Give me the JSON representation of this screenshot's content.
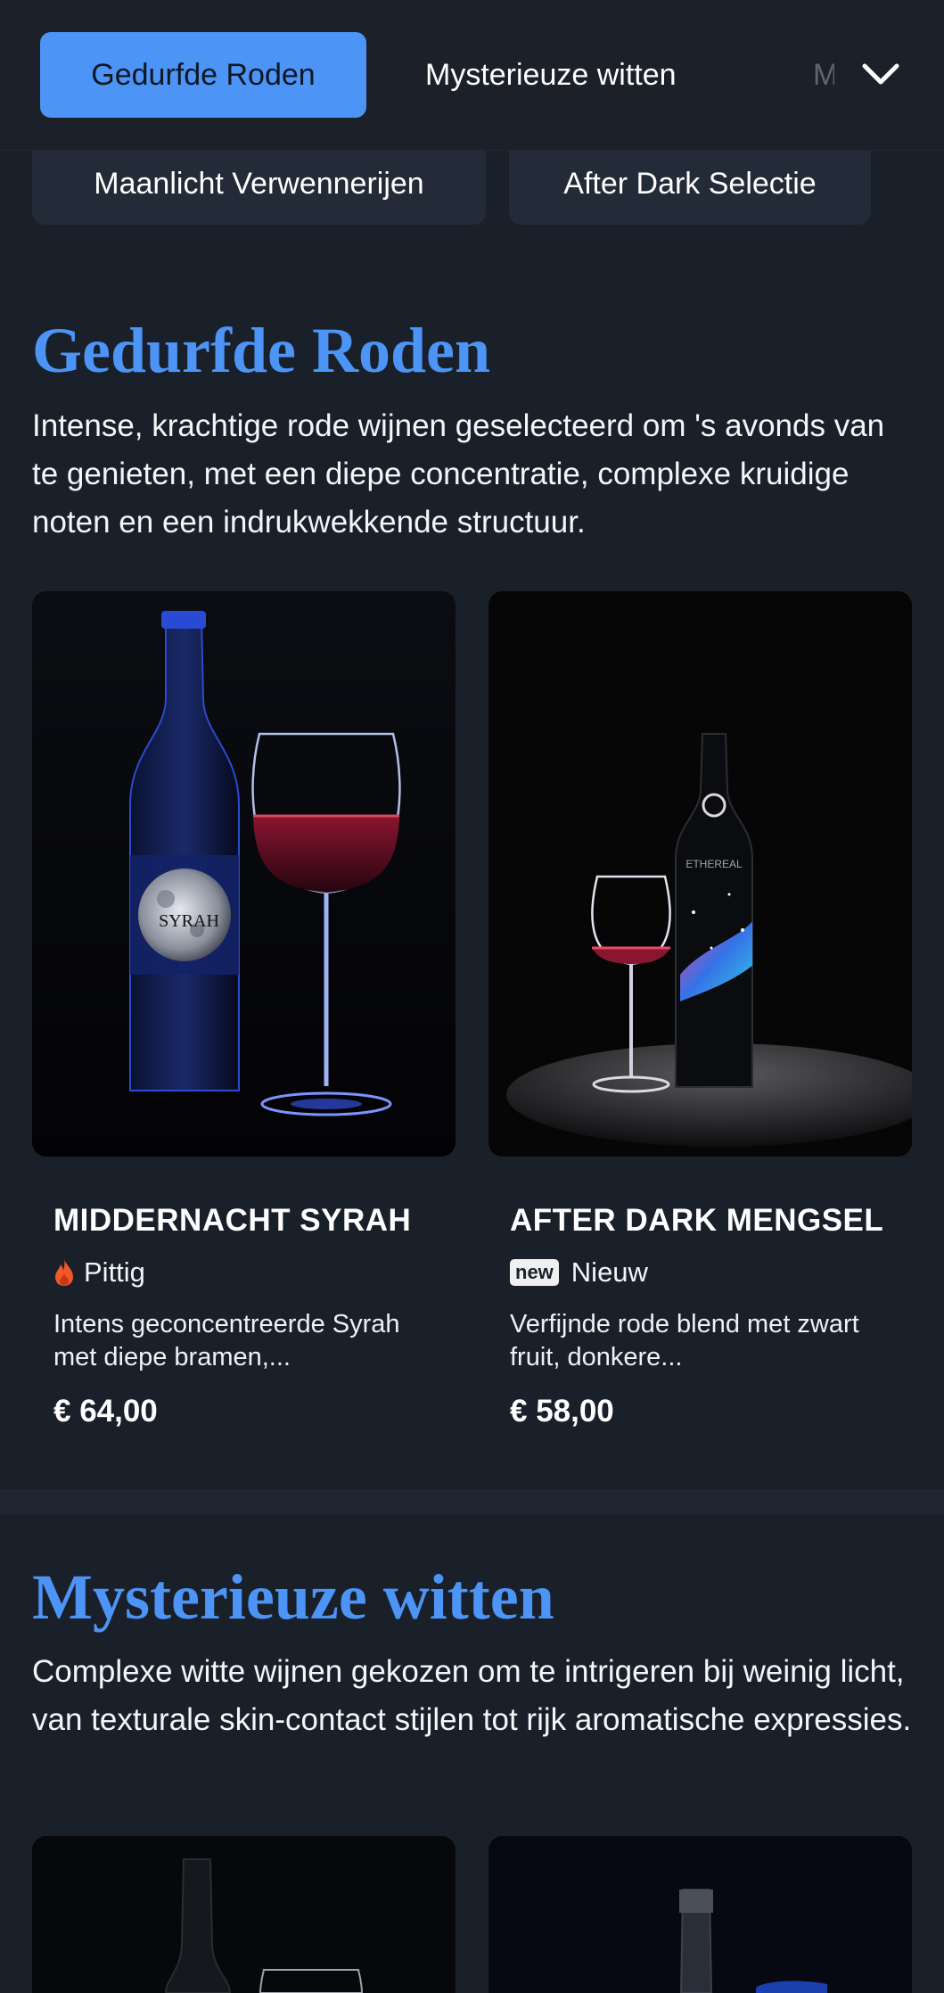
{
  "nav": {
    "tabs": [
      {
        "label": "Gedurfde Roden",
        "active": true
      },
      {
        "label": "Mysterieuze witten",
        "active": false
      },
      {
        "label": "M",
        "active": false
      }
    ],
    "more_icon": "chevron-down-icon"
  },
  "category_pills": [
    {
      "label": "Maanlicht Verwennerijen"
    },
    {
      "label": "After Dark Selectie"
    }
  ],
  "sections": [
    {
      "title": "Gedurfde Roden",
      "description": "Intense, krachtige rode wijnen geselecteerd om 's avonds van te genieten, met een diepe concentratie, complexe kruidige noten en een indrukwekkende structuur.",
      "products": [
        {
          "name": "MIDDERNACHT SYRAH",
          "badge_label": "Pittig",
          "badge_icon": "flame-icon",
          "description": "Intens geconcentreerde Syrah met diepe bramen,...",
          "price": "€ 64,00",
          "bottle_label": "SYRAH"
        },
        {
          "name": "AFTER DARK MENGSEL",
          "badge_pill": "new",
          "badge_label": "Nieuw",
          "description": "Verfijnde rode blend met zwart fruit, donkere...",
          "price": "€ 58,00",
          "bottle_label": "ETHEREAL"
        }
      ]
    },
    {
      "title": "Mysterieuze witten",
      "description": "Complexe witte wijnen gekozen om te intrigeren bij weinig licht, van texturale skin-contact stijlen tot rijk aromatische expressies."
    }
  ],
  "colors": {
    "background": "#1a2029",
    "accent": "#4d94f7",
    "flame": "#f0582a"
  }
}
